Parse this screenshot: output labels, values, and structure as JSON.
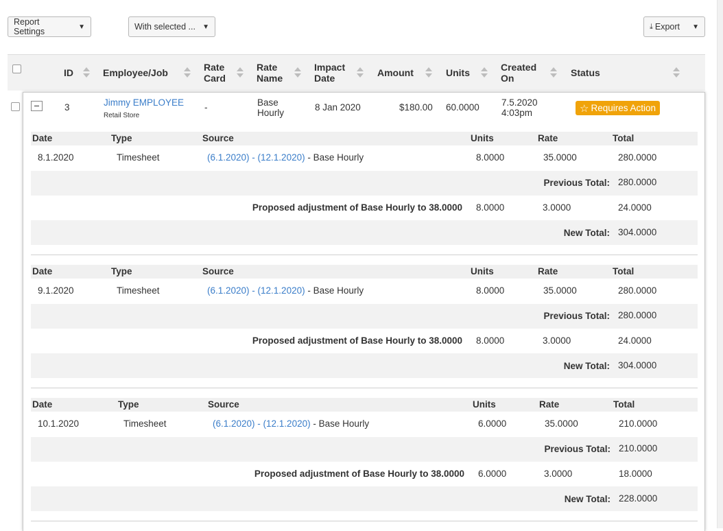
{
  "toolbar": {
    "report_settings": "Report Settings",
    "with_selected": "With selected ...",
    "export": "Export"
  },
  "columns": [
    "ID",
    "Employee/Job",
    "Rate Card",
    "Rate Name",
    "Impact Date",
    "Amount",
    "Units",
    "Created On",
    "Status"
  ],
  "columns_display": {
    "id": "ID",
    "employee": "Employee/Job",
    "rate_card_1": "Rate",
    "rate_card_2": "Card",
    "rate_name_1": "Rate",
    "rate_name_2": "Name",
    "impact_1": "Impact",
    "impact_2": "Date",
    "amount": "Amount",
    "units": "Units",
    "created_1": "Created",
    "created_2": "On",
    "status": "Status"
  },
  "row": {
    "id": "3",
    "employee": "Jimmy EMPLOYEE",
    "job": "Retail Store",
    "rate_card": "-",
    "rate_name_1": "Base",
    "rate_name_2": "Hourly",
    "impact_date": "8 Jan 2020",
    "amount": "$180.00",
    "units": "60.0000",
    "created_1": "7.5.2020",
    "created_2": "4:03pm",
    "status": "Requires Action",
    "status_color": "#f0a30a"
  },
  "detail_headers": {
    "date": "Date",
    "type": "Type",
    "source": "Source",
    "units": "Units",
    "rate": "Rate",
    "total": "Total"
  },
  "labels": {
    "previous_total": "Previous Total:",
    "new_total": "New Total:"
  },
  "details": [
    {
      "date": "8.1.2020",
      "type": "Timesheet",
      "source_link": "(6.1.2020) - (12.1.2020)",
      "source_suffix": " - Base Hourly",
      "units": "8.0000",
      "rate": "35.0000",
      "total": "280.0000",
      "previous_total": "280.0000",
      "adjustment_label": "Proposed adjustment of Base Hourly to 38.0000",
      "adj_units": "8.0000",
      "adj_rate": "3.0000",
      "adj_total": "24.0000",
      "new_total": "304.0000"
    },
    {
      "date": "9.1.2020",
      "type": "Timesheet",
      "source_link": "(6.1.2020) - (12.1.2020)",
      "source_suffix": " - Base Hourly",
      "units": "8.0000",
      "rate": "35.0000",
      "total": "280.0000",
      "previous_total": "280.0000",
      "adjustment_label": "Proposed adjustment of Base Hourly to 38.0000",
      "adj_units": "8.0000",
      "adj_rate": "3.0000",
      "adj_total": "24.0000",
      "new_total": "304.0000"
    },
    {
      "date": "10.1.2020",
      "type": "Timesheet",
      "source_link": "(6.1.2020) - (12.1.2020)",
      "source_suffix": " - Base Hourly",
      "units": "6.0000",
      "rate": "35.0000",
      "total": "210.0000",
      "previous_total": "210.0000",
      "adjustment_label": "Proposed adjustment of Base Hourly to 38.0000",
      "adj_units": "6.0000",
      "adj_rate": "3.0000",
      "adj_total": "18.0000",
      "new_total": "228.0000"
    }
  ]
}
